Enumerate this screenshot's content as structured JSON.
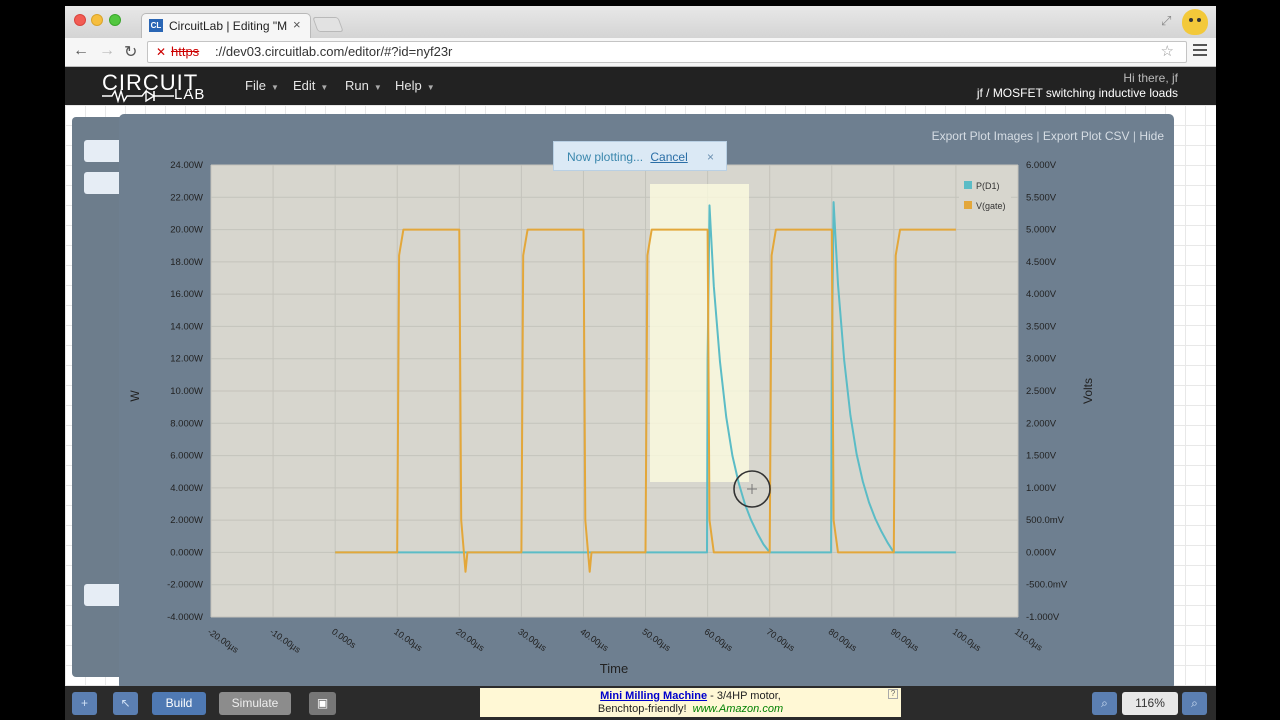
{
  "browser": {
    "tab_title": "CircuitLab | Editing \"MOSF",
    "tab_close": "×",
    "favicon_text": "CL",
    "url_protocol": "https",
    "url_rest": "://dev03.circuitlab.com/editor/#?id=nyf23r"
  },
  "app": {
    "logo_top": "CIRCUIT",
    "logo_bottom": "LAB",
    "menu": [
      "File",
      "Edit",
      "Run",
      "Help"
    ],
    "greeting": "Hi there, jf",
    "doc_title": "jf / MOSFET switching inductive loads"
  },
  "plot": {
    "links": [
      "Export Plot Images",
      "Export Plot CSV",
      "Hide"
    ],
    "notice_text": "Now plotting...",
    "notice_cancel": "Cancel",
    "notice_close": "×"
  },
  "bottom_bar": {
    "build": "Build",
    "simulate": "Simulate",
    "ad_title": "Mini Milling Machine",
    "ad_line1_rest": " - 3/4HP motor,",
    "ad_line2": "Benchtop-friendly!",
    "ad_site": "www.Amazon.com",
    "zoom": "116%"
  },
  "chart_data": {
    "type": "line",
    "xlabel": "Time",
    "ylabel_left": "W",
    "ylabel_right": "Volts",
    "x_ticks": [
      "-20.00µs",
      "-10.00µs",
      "0.000s",
      "10.00µs",
      "20.00µs",
      "30.00µs",
      "40.00µs",
      "50.00µs",
      "60.00µs",
      "70.00µs",
      "80.00µs",
      "90.00µs",
      "100.0µs",
      "110.0µs"
    ],
    "xlim": [
      -20,
      110
    ],
    "y_left_ticks": [
      "24.00W",
      "22.00W",
      "20.00W",
      "18.00W",
      "16.00W",
      "14.00W",
      "12.00W",
      "10.00W",
      "8.000W",
      "6.000W",
      "4.000W",
      "2.000W",
      "0.000W",
      "-2.000W",
      "-4.000W"
    ],
    "ylim_left": [
      -4,
      24
    ],
    "y_right_ticks": [
      "6.000V",
      "5.500V",
      "5.000V",
      "4.500V",
      "4.000V",
      "3.500V",
      "3.000V",
      "2.500V",
      "2.000V",
      "1.500V",
      "1.000V",
      "500.0mV",
      "0.000V",
      "-500.0mV",
      "-1.000V"
    ],
    "ylim_right": [
      -1,
      6
    ],
    "grid": true,
    "legend_position": "top-right",
    "series": [
      {
        "name": "P(D1)",
        "axis": "left",
        "color": "#5bbcc6",
        "x": [
          0,
          59.9,
          60,
          60.3,
          61,
          62,
          63,
          64,
          65,
          66,
          67,
          68,
          69,
          70,
          79.9,
          80,
          80.3,
          81,
          82,
          83,
          84,
          85,
          86,
          87,
          88,
          89,
          90,
          100
        ],
        "y": [
          0,
          0,
          12,
          21.5,
          16.5,
          11.8,
          8.4,
          6.0,
          4.3,
          3.0,
          2.0,
          1.2,
          0.5,
          0,
          0,
          12,
          21.7,
          16.6,
          11.9,
          8.5,
          6.1,
          4.4,
          3.1,
          2.1,
          1.3,
          0.6,
          0,
          0
        ]
      },
      {
        "name": "V(gate)",
        "axis": "right",
        "color": "#e3a73a",
        "x": [
          0,
          10,
          10.3,
          11,
          20,
          20.3,
          21,
          21.3,
          22,
          30,
          30.3,
          31,
          40,
          40.3,
          41,
          41.3,
          42,
          50,
          50.3,
          51,
          60,
          60.3,
          61,
          70,
          70.3,
          71,
          80,
          80.3,
          81,
          90,
          90.3,
          91,
          100
        ],
        "y": [
          0,
          0,
          4.6,
          5,
          5,
          0.5,
          -0.3,
          0,
          0,
          0,
          4.6,
          5,
          5,
          0.5,
          -0.3,
          0,
          0,
          0,
          4.6,
          5,
          5,
          0.5,
          0,
          0,
          4.6,
          5,
          5,
          0.5,
          0,
          0,
          4.6,
          5,
          5
        ]
      }
    ]
  }
}
